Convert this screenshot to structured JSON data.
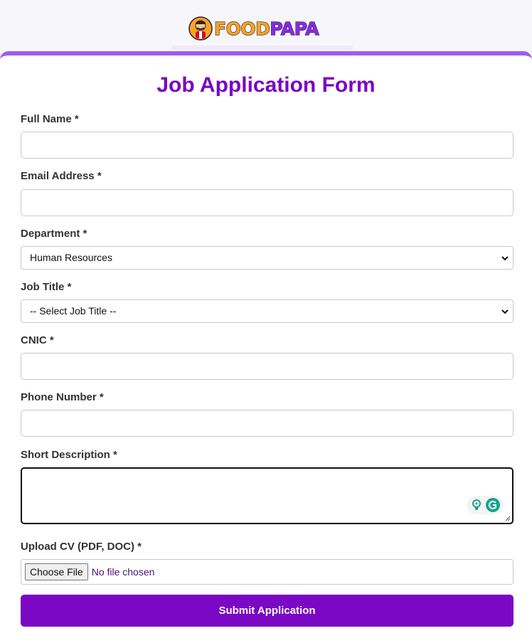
{
  "brand": {
    "logo_word1": "FOOD",
    "logo_word2": "PAPA",
    "logo_color1": "#f7a51a",
    "logo_color2": "#8a2be2"
  },
  "form": {
    "title": "Job Application Form",
    "accent_color": "#7a06c1",
    "fields": {
      "full_name": {
        "label": "Full Name *",
        "value": ""
      },
      "email": {
        "label": "Email Address *",
        "value": ""
      },
      "department": {
        "label": "Department *",
        "selected": "Human Resources"
      },
      "job_title": {
        "label": "Job Title *",
        "selected": "-- Select Job Title --"
      },
      "cnic": {
        "label": "CNIC *",
        "value": ""
      },
      "phone": {
        "label": "Phone Number *",
        "value": ""
      },
      "description": {
        "label": "Short Description *",
        "value": ""
      },
      "cv": {
        "label": "Upload CV (PDF, DOC) *",
        "button_label": "Choose File",
        "status": "No file chosen"
      }
    },
    "submit_label": "Submit Application"
  },
  "icons": {
    "logo_mascot": "mascot-icon",
    "dropdown": "chevron-down-icon",
    "grammarly_hint": "lightbulb-icon",
    "grammarly": "grammarly-icon",
    "resize": "resize-handle-icon"
  }
}
